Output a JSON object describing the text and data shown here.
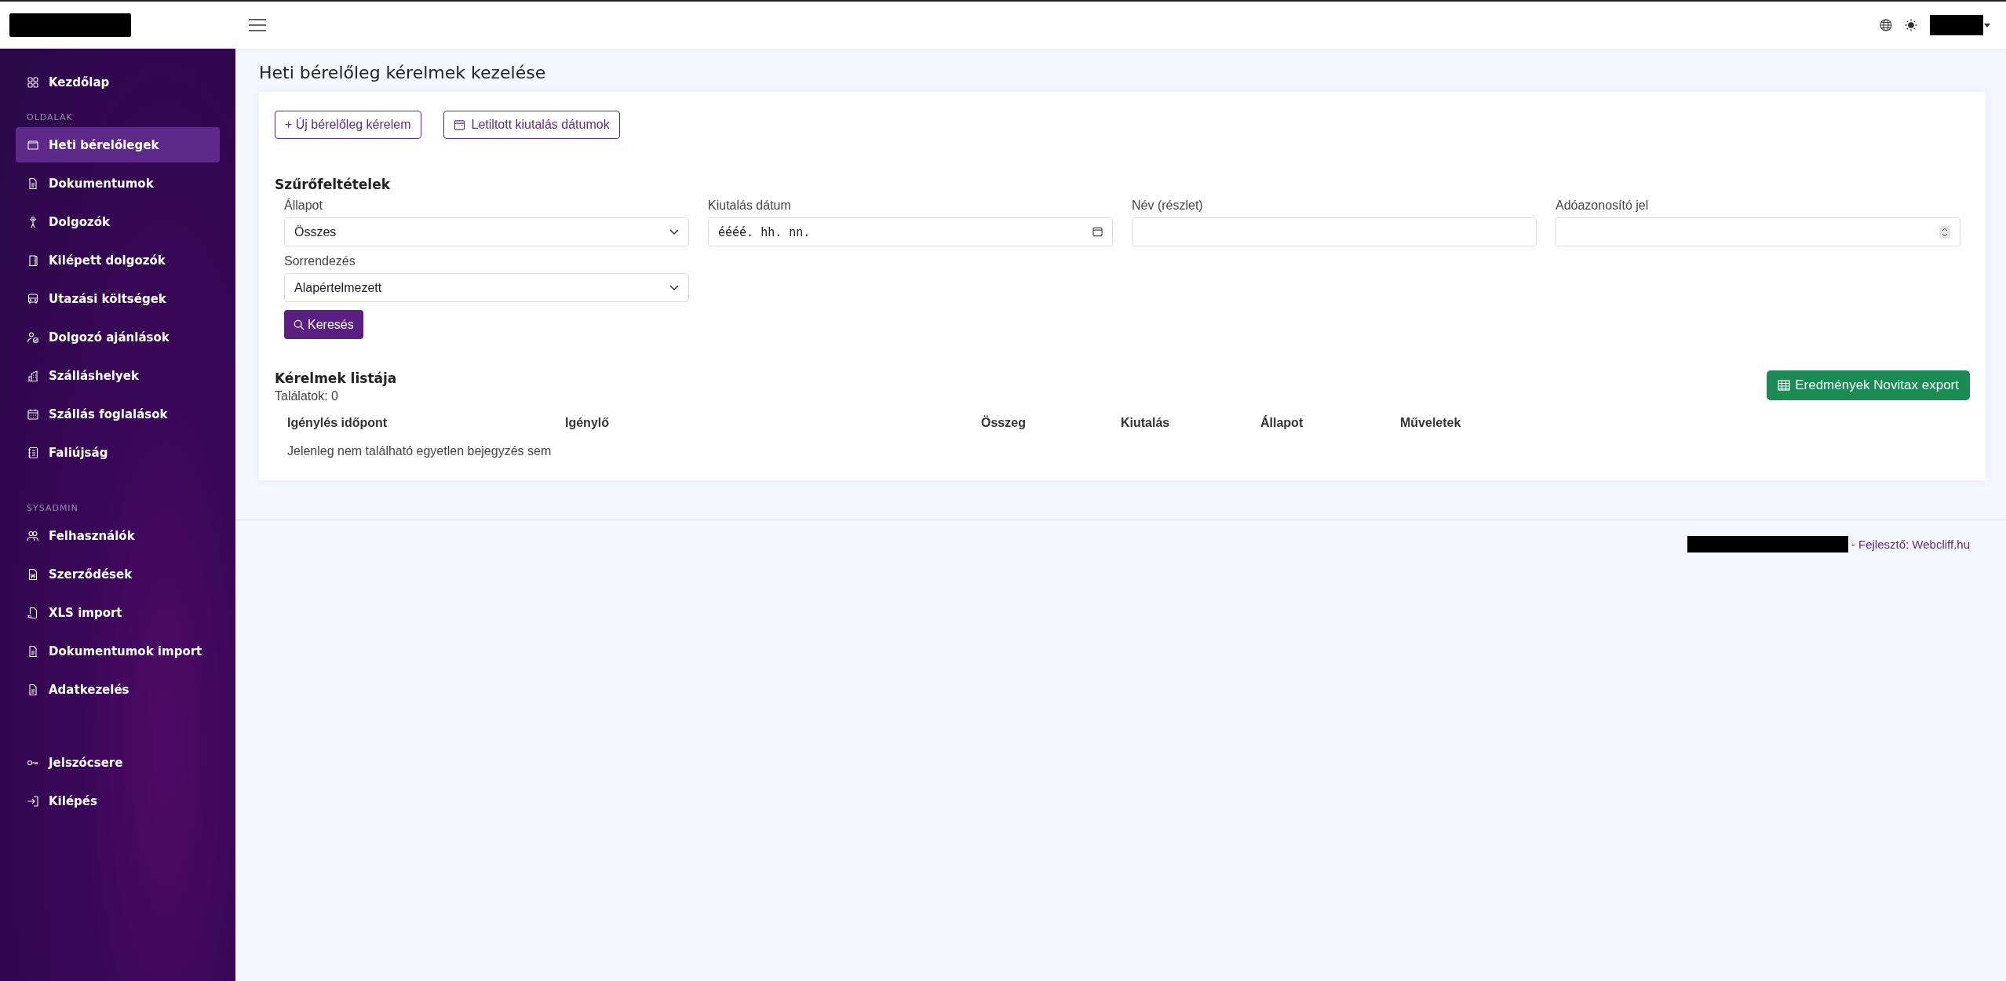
{
  "sidebar": {
    "sections": [
      {
        "items": [
          {
            "label": "Kezdőlap",
            "selected": false
          }
        ]
      },
      {
        "heading": "OLDALAK",
        "items": [
          {
            "label": "Heti bérelőlegek",
            "selected": true
          },
          {
            "label": "Dokumentumok",
            "selected": false
          },
          {
            "label": "Dolgozók",
            "selected": false
          },
          {
            "label": "Kilépett dolgozók",
            "selected": false
          },
          {
            "label": "Utazási költségek",
            "selected": false
          },
          {
            "label": "Dolgozó ajánlások",
            "selected": false
          },
          {
            "label": "Szálláshelyek",
            "selected": false
          },
          {
            "label": "Szállás foglalások",
            "selected": false
          },
          {
            "label": "Faliújság",
            "selected": false
          }
        ]
      },
      {
        "heading": "SYSADMIN",
        "items": [
          {
            "label": "Felhasználók",
            "selected": false
          },
          {
            "label": "Szerződések",
            "selected": false
          },
          {
            "label": "XLS import",
            "selected": false
          },
          {
            "label": "Dokumentumok import",
            "selected": false
          },
          {
            "label": "Adatkezelés",
            "selected": false
          }
        ]
      },
      {
        "items": [
          {
            "label": "Jelszócsere",
            "selected": false
          },
          {
            "label": "Kilépés",
            "selected": false
          }
        ]
      }
    ]
  },
  "page_title": "Heti bérelőleg kérelmek kezelése",
  "actions": [
    {
      "label": "+ Új bérelőleg kérelem",
      "kind": "plain"
    },
    {
      "label": "Letiltott kiutalás dátumok",
      "kind": "calendar"
    }
  ],
  "filters": {
    "title": "Szűrőfeltételek",
    "fields": [
      {
        "label": "Állapot",
        "kind": "select",
        "value": "Összes"
      },
      {
        "label": "Kiutalás dátum",
        "kind": "date",
        "placeholder": "éééé. hh. nn."
      },
      {
        "label": "Név (részlet)",
        "kind": "text"
      },
      {
        "label": "Adóazonosító jel",
        "kind": "number"
      },
      {
        "label": "Sorrendezés",
        "kind": "select",
        "value": "Alapértelmezett"
      }
    ],
    "search_button": "Keresés"
  },
  "list": {
    "title": "Kérelmek listája",
    "count": "Találatok: 0",
    "export_button": "Eredmények Novitax export",
    "columns": [
      "Igénylés időpont",
      "Igénylő",
      "Összeg",
      "Kiutalás",
      "Állapot",
      "Műveletek"
    ],
    "empty_message": "Jelenleg nem található egyetlen bejegyzés sem"
  },
  "footer": {
    "credit": "- Fejlesztő: Webcliff.hu"
  }
}
